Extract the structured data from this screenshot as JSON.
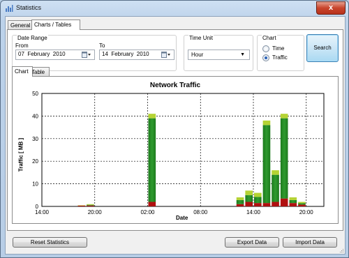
{
  "window": {
    "title": "Statistics",
    "close_glyph": "x"
  },
  "tabs": [
    {
      "label": "General"
    },
    {
      "label": "Charts / Tables"
    }
  ],
  "date_range": {
    "group_label": "Date Range",
    "from_label": "From",
    "from_value": "07  February  2010",
    "to_label": "To",
    "to_value": "14  February  2010"
  },
  "time_unit": {
    "group_label": "Time Unit",
    "selected": "Hour"
  },
  "chart_mode": {
    "group_label": "Chart",
    "options": [
      "Time",
      "Traffic"
    ],
    "selected": "Traffic"
  },
  "search_label": "Search",
  "view_tabs": [
    {
      "label": "Chart"
    },
    {
      "label": "Table"
    }
  ],
  "buttons": {
    "reset": "Reset Statistics",
    "export": "Export Data",
    "import": "Import Data"
  },
  "colors": {
    "bar_top": "#b5d334",
    "bar_main": "#2f9a2f",
    "bar_base": "#b01010"
  },
  "chart_data": {
    "type": "bar",
    "title": "Network Traffic",
    "xlabel": "Date",
    "ylabel": "Traffic [ MB ]",
    "ylim": [
      0,
      50
    ],
    "yticks": [
      "0",
      "10",
      "20",
      "30",
      "40",
      "50"
    ],
    "xticks": [
      "14:00",
      "20:00",
      "02:00",
      "08:00",
      "14:00",
      "20:00"
    ],
    "grid": true,
    "stacked": true,
    "bars": [
      {
        "x": "2010-02-07 18:00",
        "total": 0.5,
        "base": 0.4
      },
      {
        "x": "2010-02-07 19:00",
        "total": 1.0,
        "base": 0.4
      },
      {
        "x": "2010-02-08 02:00",
        "total": 41,
        "base": 2
      },
      {
        "x": "2010-02-08 12:00",
        "total": 4,
        "base": 1
      },
      {
        "x": "2010-02-08 13:00",
        "total": 7,
        "base": 2
      },
      {
        "x": "2010-02-08 14:00",
        "total": 6,
        "base": 1.5
      },
      {
        "x": "2010-02-08 15:00",
        "total": 38,
        "base": 1.5
      },
      {
        "x": "2010-02-08 16:00",
        "total": 16,
        "base": 2
      },
      {
        "x": "2010-02-08 17:00",
        "total": 41,
        "base": 3.5
      },
      {
        "x": "2010-02-08 18:00",
        "total": 4,
        "base": 1.5
      },
      {
        "x": "2010-02-08 19:00",
        "total": 2,
        "base": 0.8
      }
    ]
  }
}
